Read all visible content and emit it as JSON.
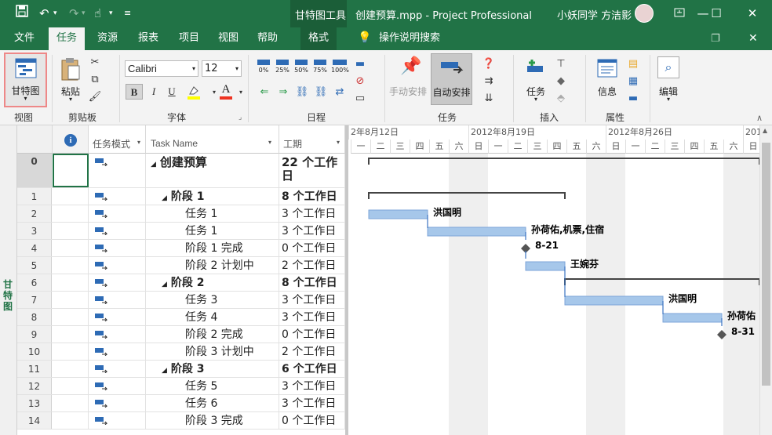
{
  "titlebar": {
    "context_tool": "甘特图工具",
    "doc_title": "创建预算.mpp - Project Professional",
    "user": "小妖同学 方洁影"
  },
  "tabs": [
    "文件",
    "任务",
    "资源",
    "报表",
    "项目",
    "视图",
    "帮助",
    "格式"
  ],
  "tell_me": "操作说明搜索",
  "ribbon": {
    "view_group": {
      "button": "甘特图",
      "label": "视图"
    },
    "clipboard_group": {
      "paste": "粘贴",
      "label": "剪贴板"
    },
    "font_group": {
      "font_name": "Calibri",
      "font_size": "12",
      "bold": "B",
      "italic": "I",
      "underline": "U",
      "label": "字体"
    },
    "schedule_group": {
      "percents": [
        "0%",
        "25%",
        "50%",
        "75%",
        "100%"
      ],
      "label": "日程"
    },
    "tasks_group": {
      "manual": "手动安排",
      "auto": "自动安排",
      "label": "任务"
    },
    "insert_group": {
      "task": "任务",
      "label": "插入"
    },
    "properties_group": {
      "info": "信息",
      "label": "属性"
    },
    "editing_group": {
      "edit": "编辑"
    }
  },
  "side_label": "甘特图",
  "grid": {
    "headers": {
      "info": "i",
      "mode": "任务模式",
      "name": "Task Name",
      "duration": "工期"
    },
    "rows": [
      {
        "id": "0",
        "name": "创建预算",
        "duration": "22 个工作日",
        "level": 0,
        "summary": true
      },
      {
        "id": "1",
        "name": "阶段 1",
        "duration": "8 个工作日",
        "level": 1,
        "summary": true
      },
      {
        "id": "2",
        "name": "任务 1",
        "duration": "3 个工作日",
        "level": 2,
        "summary": false
      },
      {
        "id": "3",
        "name": "任务 1",
        "duration": "3 个工作日",
        "level": 2,
        "summary": false
      },
      {
        "id": "4",
        "name": "阶段 1 完成",
        "duration": "0 个工作日",
        "level": 2,
        "summary": false
      },
      {
        "id": "5",
        "name": "阶段 2 计划中",
        "duration": "2 个工作日",
        "level": 2,
        "summary": false
      },
      {
        "id": "6",
        "name": "阶段 2",
        "duration": "8 个工作日",
        "level": 1,
        "summary": true
      },
      {
        "id": "7",
        "name": "任务 3",
        "duration": "3 个工作日",
        "level": 2,
        "summary": false
      },
      {
        "id": "8",
        "name": "任务 4",
        "duration": "3 个工作日",
        "level": 2,
        "summary": false
      },
      {
        "id": "9",
        "name": "阶段 2 完成",
        "duration": "0 个工作日",
        "level": 2,
        "summary": false
      },
      {
        "id": "10",
        "name": "阶段 3 计划中",
        "duration": "2 个工作日",
        "level": 2,
        "summary": false
      },
      {
        "id": "11",
        "name": "阶段 3",
        "duration": "6 个工作日",
        "level": 1,
        "summary": true
      },
      {
        "id": "12",
        "name": "任务 5",
        "duration": "3 个工作日",
        "level": 2,
        "summary": false
      },
      {
        "id": "13",
        "name": "任务 6",
        "duration": "3 个工作日",
        "level": 2,
        "summary": false
      },
      {
        "id": "14",
        "name": "阶段 3 完成",
        "duration": "0 个工作日",
        "level": 2,
        "summary": false
      }
    ]
  },
  "timescale": {
    "weeks": [
      "2年8月12日",
      "2012年8月19日",
      "2012年8月26日",
      "201"
    ],
    "days": [
      "一",
      "二",
      "三",
      "四",
      "五",
      "六",
      "日",
      "一",
      "二",
      "三",
      "四",
      "五",
      "六",
      "日",
      "一",
      "二",
      "三",
      "四",
      "五",
      "六",
      "日"
    ]
  },
  "gantt_labels": {
    "r2": "洪国明",
    "r3": "孙荷佑,机票,住宿",
    "r4": "8-21",
    "r5": "王婉芬",
    "r7": "洪国明",
    "r8": "孙荷佑",
    "r9": "8-31"
  },
  "colors": {
    "brand": "#217346",
    "bar": "#a6c7ea",
    "link": "#3b73c0"
  }
}
